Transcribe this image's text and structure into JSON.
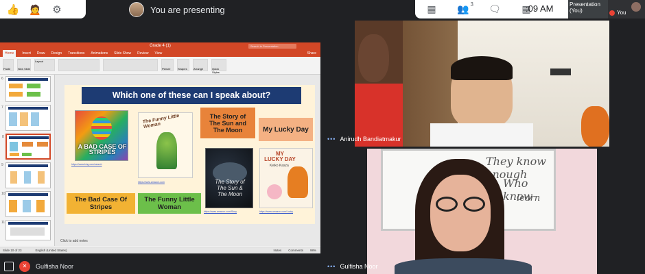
{
  "presenter_banner": {
    "text": "You are presenting"
  },
  "top_right": {
    "time": ":09 AM",
    "people_badge": "3",
    "presentation_tile": "Presentation\n(You)",
    "you_tile": "You"
  },
  "ppt": {
    "title": "Grade 4 (1)",
    "search_placeholder": "Search in Presentation",
    "share": "Share",
    "tabs": [
      "Home",
      "Insert",
      "Draw",
      "Design",
      "Transitions",
      "Animations",
      "Slide Show",
      "Review",
      "View"
    ],
    "ribbon_labels": {
      "paste": "Paste",
      "new_slide": "New Slide",
      "layout": "Layout",
      "reset": "Reset",
      "section": "Section",
      "picture": "Picture",
      "shapes": "Shapes",
      "arrange": "Arrange",
      "quick_styles": "Quick Styles"
    },
    "slide_numbers": [
      "6",
      "7",
      "8",
      "9",
      "10",
      "11"
    ],
    "notes": "Click to add notes",
    "status": {
      "slide": "Slide 10 of 23",
      "lang": "English (United States)",
      "notes": "Notes",
      "comments": "Comments",
      "zoom": "98%"
    }
  },
  "slide": {
    "question": "Which one of these can I speak about?",
    "labels": {
      "story_sun_moon": "The Story of\nThe Sun and\nThe Moon",
      "lucky_day": "My Lucky Day",
      "bad_case": "The Bad Case Of\nStripes",
      "funny_woman": "The Funny Little\nWoman"
    },
    "book_covers": {
      "stripes": "A BAD CASE OF\nSTRIPES",
      "funny": "The Funny Little Woman",
      "sun_moon": "The Story of\nThe Sun &\nThe Moon",
      "lucky": "MY\nLUCKY DAY",
      "lucky_author": "Keiko Kasza"
    }
  },
  "participants": {
    "video1_name": "Anirudh Bandiatmakur",
    "video2_name": "Gulfisha Noor",
    "self_name": "Gulfisha Noor"
  },
  "whiteboard": {
    "line1": "They know enough",
    "line2": "Who know",
    "line3": "learn"
  }
}
